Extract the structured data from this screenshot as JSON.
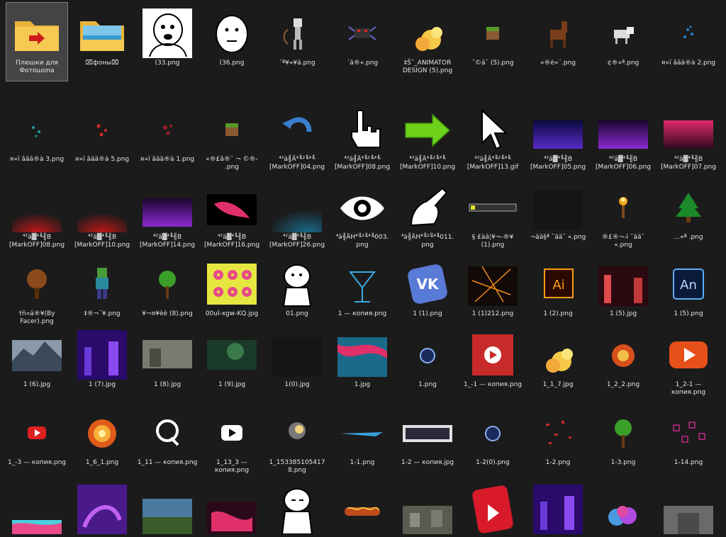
{
  "files": [
    {
      "label": "Плюшки для Фотошопа",
      "kind": "folder",
      "selected": true
    },
    {
      "label": "⌧фоны⌧",
      "kind": "folder-img"
    },
    {
      "label": "(33.png",
      "kind": "meme1"
    },
    {
      "label": "(36.png",
      "kind": "meme2"
    },
    {
      "label": "´ª¥«¥ä.png",
      "kind": "skeleton"
    },
    {
      "label": "´ä®«.png",
      "kind": "spider"
    },
    {
      "label": "‡Šˆ_ANIMATOR DESIGN (5).png",
      "kind": "explosion-small"
    },
    {
      "label": "˝©ä˜ (5).png",
      "kind": "grass-block"
    },
    {
      "label": "«®è«¨­.png",
      "kind": "horse"
    },
    {
      "label": "¢®«ª.png",
      "kind": "wolf"
    },
    {
      "label": "¤«ï âää®à 2.png",
      "kind": "dots-blue"
    },
    {
      "label": "¤«ï âää®à 3.png",
      "kind": "dots-teal"
    },
    {
      "label": "¤«ï âää®à 5.png",
      "kind": "dots-red"
    },
    {
      "label": "¤«ï âää®à 1.png",
      "kind": "dots-red2"
    },
    {
      "label": "«®£â®¯ ¬ ©®- .png",
      "kind": "grass-block"
    },
    {
      "label": "⁴²ä╢Ä⁴╙²╙⁴╙ [MarkOFF]04.png",
      "kind": "arrow-curve"
    },
    {
      "label": "⁴²ä╢Ä⁴╙²╙⁴╙ [MarkOFF]08.png",
      "kind": "hand-cursor"
    },
    {
      "label": "⁴²ä╢Ä⁴╙²╙⁴╙ [MarkOFF]10.png",
      "kind": "green-arrow"
    },
    {
      "label": "⁴²ä╢Ä⁴╙²╙⁴╙ [MarkOFF]13.gif",
      "kind": "cursor"
    },
    {
      "label": "⁴²ä▓⁴╙╢B [MarkOFF]05.png",
      "kind": "grad-blue"
    },
    {
      "label": "⁴²ä▓⁴╙╢B [MarkOFF]06.png",
      "kind": "grad-purple"
    },
    {
      "label": "⁴²ä▓⁴╙╢B [MarkOFF]07.png",
      "kind": "grad-pink"
    },
    {
      "label": "⁴²ä▓⁴╙╢B [MarkOFF]08.png",
      "kind": "glow-red"
    },
    {
      "label": "⁴²ä▓⁴╙╢B [MarkOFF]10.png",
      "kind": "glow-red"
    },
    {
      "label": "⁴²ä▓⁴╙╢B [MarkOFF]14.png",
      "kind": "grad-purple"
    },
    {
      "label": "⁴²ä▓⁴╙╢B [MarkOFF]16.png",
      "kind": "pink-splash"
    },
    {
      "label": "⁴²ä▓⁴╙╢B [MarkOFF]26.png",
      "kind": "glow-teal"
    },
    {
      "label": "⁴ä╢ÄH⁴╙²╙⁴╙003. png",
      "kind": "eye"
    },
    {
      "label": "⁴ä╢ÄH⁴╙²╙⁴╙011. png",
      "kind": "finger"
    },
    {
      "label": "§ £àä¦¥¬-®¥ (1).png",
      "kind": "subscribe"
    },
    {
      "label": "¬ää§ª ˜ää˜ «.png",
      "kind": "dark"
    },
    {
      "label": "®£®¬-ì ˜ää˜ «.png",
      "kind": "torch"
    },
    {
      "label": "...«ª .png",
      "kind": "xmas-tree"
    },
    {
      "label": "†ñ«ä®¥(By Facer).png",
      "kind": "tree-brown"
    },
    {
      "label": "‡®¬¨¥.png",
      "kind": "zombie"
    },
    {
      "label": "¥¬¤¥èè (8).png",
      "kind": "tree-green"
    },
    {
      "label": "00ul-xgw-KQ.jpg",
      "kind": "donuts"
    },
    {
      "label": "01.png",
      "kind": "meme3"
    },
    {
      "label": "1 — копия.png",
      "kind": "cocktail"
    },
    {
      "label": "1 (1).png",
      "kind": "vk"
    },
    {
      "label": "1 (1)212.png",
      "kind": "sparks"
    },
    {
      "label": "1 (2).png",
      "kind": "ai"
    },
    {
      "label": "1 (5).jpg",
      "kind": "city-red"
    },
    {
      "label": "1 (5).png",
      "kind": "an"
    },
    {
      "label": "1 (6).jpg",
      "kind": "landscape-mtn"
    },
    {
      "label": "1 (7).jpg",
      "kind": "neon-city"
    },
    {
      "label": "1 (8).jpg",
      "kind": "ruins"
    },
    {
      "label": "1 (9).jpg",
      "kind": "forest-green"
    },
    {
      "label": "1(0).jpg",
      "kind": "dark"
    },
    {
      "label": "1.jpg",
      "kind": "abstract"
    },
    {
      "label": "1.png",
      "kind": "c4d"
    },
    {
      "label": "1_-1 — копия.png",
      "kind": "yt-red-sq"
    },
    {
      "label": "1_1_7.jpg",
      "kind": "explosion-small"
    },
    {
      "label": "1_2_2.png",
      "kind": "explosion-red"
    },
    {
      "label": "1_2-1 — копия.png",
      "kind": "yt-orange"
    },
    {
      "label": "1_-3 — копия.png",
      "kind": "yt-small"
    },
    {
      "label": "1_6_1.png",
      "kind": "explosion-big"
    },
    {
      "label": "1_11 — копия.png",
      "kind": "q-logo"
    },
    {
      "label": "1_13_3 — копия.png",
      "kind": "yt-white"
    },
    {
      "label": "1_153385105417 8.png",
      "kind": "burst"
    },
    {
      "label": "1-1.png",
      "kind": "blade"
    },
    {
      "label": "1-2 — копия.jpg",
      "kind": "keyboard"
    },
    {
      "label": "1-2(0).png",
      "kind": "c4d"
    },
    {
      "label": "1-2.png",
      "kind": "debris"
    },
    {
      "label": "1-3.png",
      "kind": "tree-green"
    },
    {
      "label": "1-14.png",
      "kind": "squares"
    },
    {
      "label": "",
      "kind": "cyan-pink"
    },
    {
      "label": "",
      "kind": "purple-swirl"
    },
    {
      "label": "",
      "kind": "minecraft"
    },
    {
      "label": "",
      "kind": "pink-swirl"
    },
    {
      "label": "",
      "kind": "meme4"
    },
    {
      "label": "",
      "kind": "hotdog"
    },
    {
      "label": "",
      "kind": "town"
    },
    {
      "label": "",
      "kind": "red-arrow"
    },
    {
      "label": "",
      "kind": "neon-city"
    },
    {
      "label": "",
      "kind": "coral"
    },
    {
      "label": "",
      "kind": "street"
    }
  ]
}
